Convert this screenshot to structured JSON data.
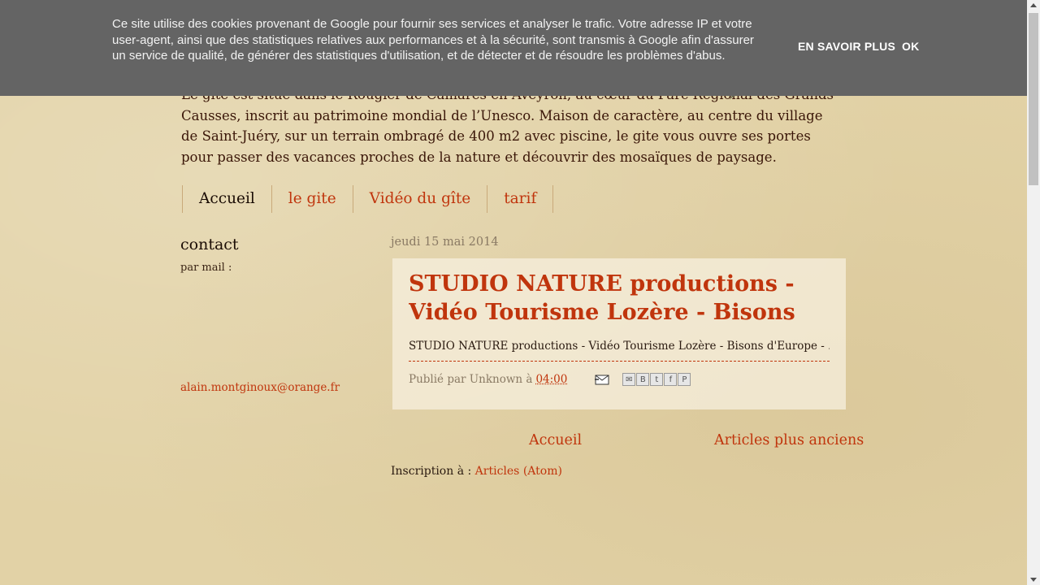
{
  "cookie_banner": {
    "text": "Ce site utilise des cookies provenant de Google pour fournir ses services et analyser le trafic. Votre adresse IP et votre user-agent, ainsi que des statistiques relatives aux performances et à la sécurité, sont transmis à Google afin d'assurer un service de qualité, de générer des statistiques d'utilisation, et de détecter et de résoudre les problèmes d'abus.",
    "learn_more": "EN SAVOIR PLUS",
    "ok": "OK"
  },
  "intro": {
    "text": "Le gîte est situé dans le Rougier de Camarès en Aveyron, au cœur du Parc Régional des Grands Causses, inscrit au patrimoine mondial de l’Unesco. Maison de caractère, au centre du village de Saint-Juéry, sur un terrain ombragé de 400 m2 avec piscine, le gite vous ouvre ses portes pour passer des vacances proches de la nature et découvrir des mosaïques de paysage."
  },
  "tabs": [
    {
      "label": "Accueil",
      "active": true
    },
    {
      "label": "le gite",
      "active": false
    },
    {
      "label": "Vidéo du gîte",
      "active": false
    },
    {
      "label": "tarif",
      "active": false
    }
  ],
  "sidebar": {
    "title": "contact",
    "label": "par mail :",
    "email": "alain.montginoux@orange.fr"
  },
  "post": {
    "date": "jeudi 15 mai 2014",
    "title": "STUDIO NATURE productions - Vidéo Tourisme Lozère - Bisons d'Europe - ...",
    "snippet": "STUDIO NATURE productions - Vidéo Tourisme Lozère - Bisons d'Europe - ...",
    "published_by": "Publié par Unknown à",
    "time": "04:00",
    "share_icons": [
      "email-share",
      "blogger-share",
      "twitter-share",
      "facebook-share",
      "pinterest-share"
    ]
  },
  "pager": {
    "home": "Accueil",
    "older": "Articles plus anciens"
  },
  "subscribe": {
    "label": "Inscription à :",
    "link": "Articles (Atom)"
  },
  "colors": {
    "link": "#c0350d",
    "banner": "#646464",
    "background": "#e2d2a6"
  }
}
